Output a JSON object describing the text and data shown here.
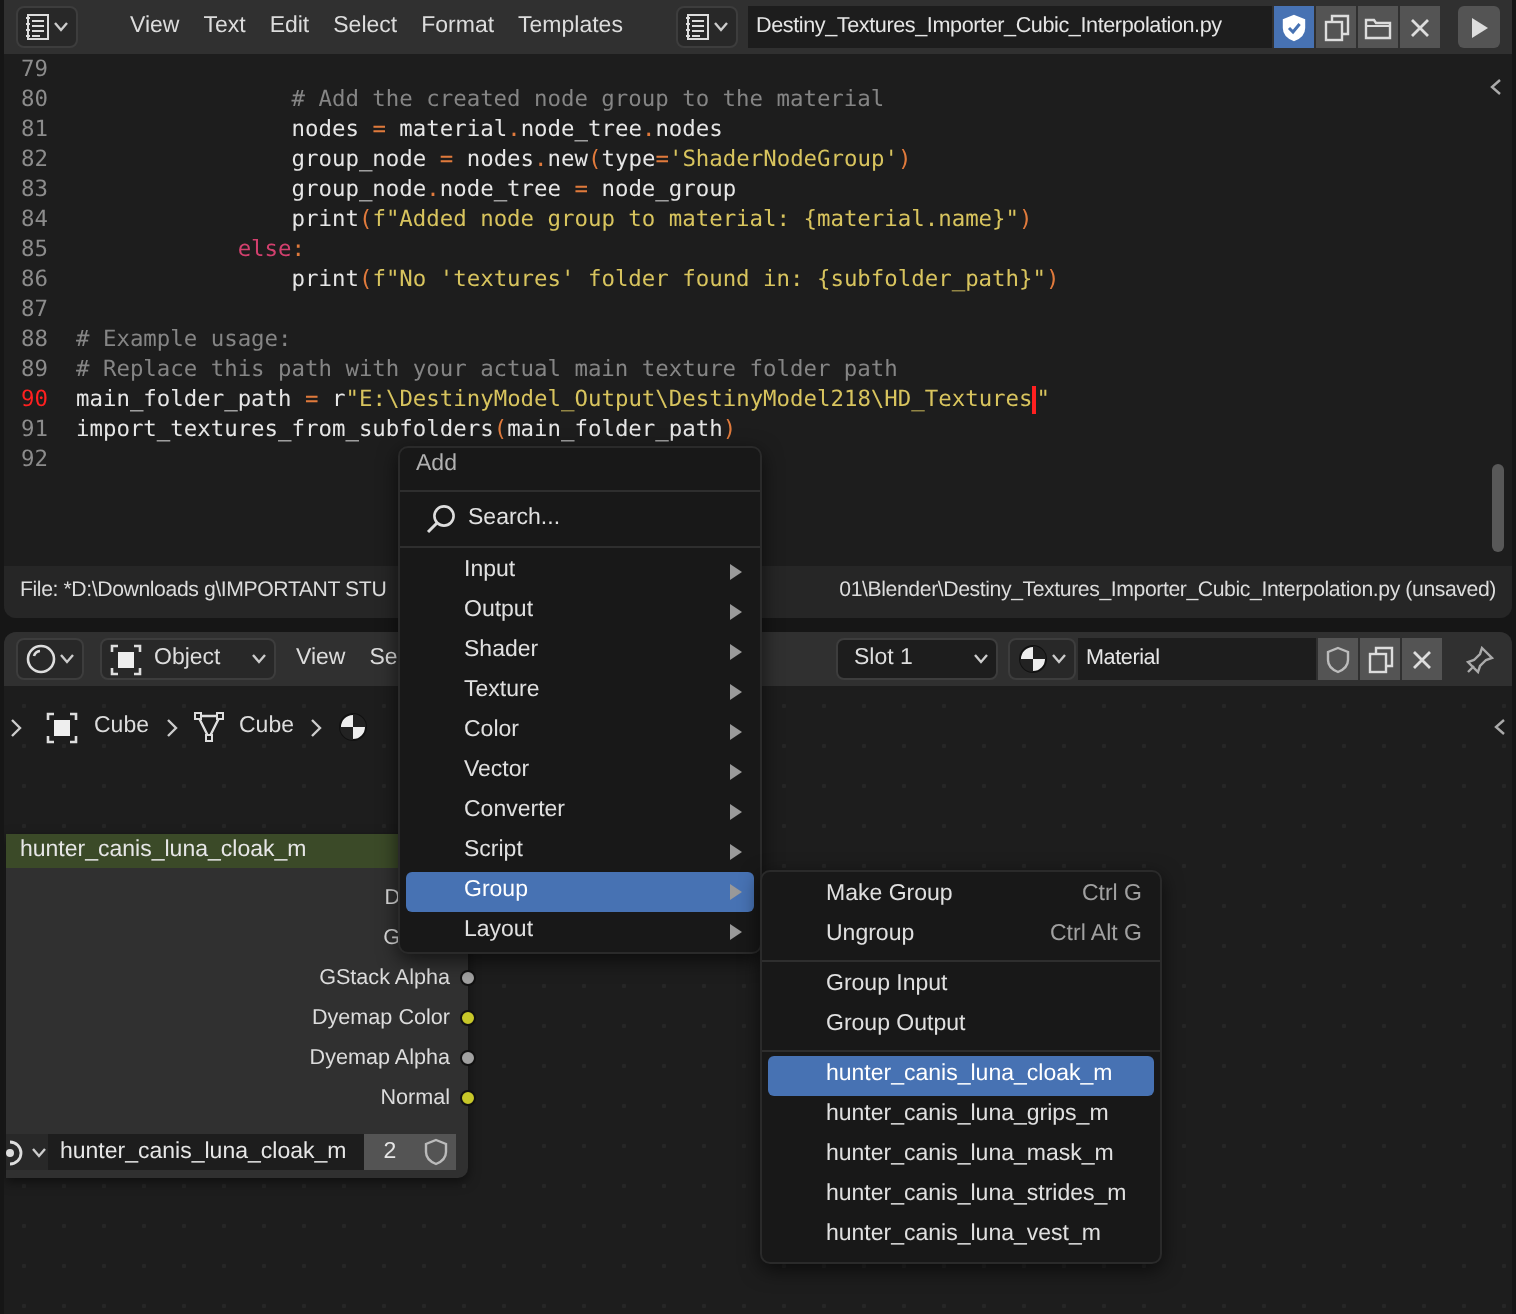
{
  "text_editor": {
    "header": {
      "menus": [
        "View",
        "Text",
        "Edit",
        "Select",
        "Format",
        "Templates"
      ],
      "filename": "Destiny_Textures_Importer_Cubic_Interpolation.py",
      "fake_user": true
    },
    "lines": [
      {
        "number": "79",
        "current": false
      },
      {
        "number": "80",
        "current": false,
        "segments": [
          {
            "kind": "comment",
            "text": "                # Add the created node group to the material"
          }
        ]
      },
      {
        "number": "81",
        "current": false,
        "segments": [
          {
            "kind": "plain",
            "text": "                nodes "
          },
          {
            "kind": "op",
            "text": "="
          },
          {
            "kind": "plain",
            "text": " material"
          },
          {
            "kind": "op",
            "text": "."
          },
          {
            "kind": "plain",
            "text": "node_tree"
          },
          {
            "kind": "op",
            "text": "."
          },
          {
            "kind": "plain",
            "text": "nodes"
          }
        ]
      },
      {
        "number": "82",
        "current": false,
        "segments": [
          {
            "kind": "plain",
            "text": "                group_node "
          },
          {
            "kind": "op",
            "text": "="
          },
          {
            "kind": "plain",
            "text": " nodes"
          },
          {
            "kind": "op",
            "text": "."
          },
          {
            "kind": "plain",
            "text": "new"
          },
          {
            "kind": "op",
            "text": "("
          },
          {
            "kind": "plain",
            "text": "type"
          },
          {
            "kind": "op",
            "text": "="
          },
          {
            "kind": "string",
            "text": "'ShaderNodeGroup'"
          },
          {
            "kind": "op",
            "text": ")"
          }
        ]
      },
      {
        "number": "83",
        "current": false,
        "segments": [
          {
            "kind": "plain",
            "text": "                group_node"
          },
          {
            "kind": "op",
            "text": "."
          },
          {
            "kind": "plain",
            "text": "node_tree "
          },
          {
            "kind": "op",
            "text": "="
          },
          {
            "kind": "plain",
            "text": " node_group"
          }
        ]
      },
      {
        "number": "84",
        "current": false,
        "segments": [
          {
            "kind": "plain",
            "text": "                print"
          },
          {
            "kind": "op",
            "text": "("
          },
          {
            "kind": "string",
            "text": "f\"Added node group to material: {material.name}\""
          },
          {
            "kind": "op",
            "text": ")"
          }
        ]
      },
      {
        "number": "85",
        "current": false,
        "segments": [
          {
            "kind": "keyword",
            "text": "            else"
          },
          {
            "kind": "op",
            "text": ":"
          }
        ]
      },
      {
        "number": "86",
        "current": false,
        "segments": [
          {
            "kind": "plain",
            "text": "                print"
          },
          {
            "kind": "op",
            "text": "("
          },
          {
            "kind": "string",
            "text": "f\"No 'textures' folder found in: {subfolder_path}\""
          },
          {
            "kind": "op",
            "text": ")"
          }
        ]
      },
      {
        "number": "87",
        "current": false
      },
      {
        "number": "88",
        "current": false,
        "segments": [
          {
            "kind": "comment",
            "text": "# Example usage:"
          }
        ]
      },
      {
        "number": "89",
        "current": false,
        "segments": [
          {
            "kind": "comment",
            "text": "# Replace this path with your actual main texture folder path"
          }
        ]
      },
      {
        "number": "90",
        "current": true,
        "segments": [
          {
            "kind": "plain",
            "text": "main_folder_path "
          },
          {
            "kind": "op",
            "text": "="
          },
          {
            "kind": "plain",
            "text": " r"
          },
          {
            "kind": "string",
            "text": "\"E:\\DestinyModel_Output\\DestinyModel218\\HD_Textures",
            "cursor_after": true
          },
          {
            "kind": "string",
            "text": "\""
          }
        ]
      },
      {
        "number": "91",
        "current": false,
        "segments": [
          {
            "kind": "plain",
            "text": "import_textures_from_subfolders"
          },
          {
            "kind": "op",
            "text": "("
          },
          {
            "kind": "plain",
            "text": "main_folder_path"
          },
          {
            "kind": "op",
            "text": ")"
          }
        ]
      },
      {
        "number": "92",
        "current": false
      }
    ],
    "status": [
      "File: *D:\\Downloads g\\IMPORTANT STU",
      "01\\Blender\\Destiny_Textures_Importer_Cubic_Interpolation.py (unsaved)"
    ]
  },
  "node_editor": {
    "header": {
      "mode": "Object",
      "menus": [
        "View",
        "Se"
      ],
      "slot": "Slot 1",
      "material": "Material",
      "fake_user": false
    },
    "breadcrumbs": [
      "Cube",
      "Cube"
    ],
    "node": {
      "title": "hunter_canis_luna_cloak_m",
      "outputs": [
        {
          "label": "D"
        },
        {
          "label": "G"
        },
        {
          "label": "GStack Alpha",
          "color": "#a1a1a1"
        },
        {
          "label": "Dyemap Color",
          "color": "#c7c729"
        },
        {
          "label": "Dyemap Alpha",
          "color": "#a1a1a1"
        },
        {
          "label": "Normal",
          "color": "#c7c729"
        }
      ],
      "datablock": "hunter_canis_luna_cloak_m",
      "users": "2",
      "fake_user": false
    }
  },
  "add_menu": {
    "title": "Add",
    "search": "Search...",
    "items": [
      {
        "label": "Input",
        "selected": false,
        "submenu": true
      },
      {
        "label": "Output",
        "selected": false,
        "submenu": true
      },
      {
        "label": "Shader",
        "selected": false,
        "submenu": true
      },
      {
        "label": "Texture",
        "selected": false,
        "submenu": true
      },
      {
        "label": "Color",
        "selected": false,
        "submenu": true
      },
      {
        "label": "Vector",
        "selected": false,
        "submenu": true
      },
      {
        "label": "Converter",
        "selected": false,
        "submenu": true
      },
      {
        "label": "Script",
        "selected": false,
        "submenu": true
      },
      {
        "label": "Group",
        "selected": true,
        "submenu": true
      },
      {
        "label": "Layout",
        "selected": false,
        "submenu": true
      }
    ]
  },
  "group_menu": {
    "sections": [
      {
        "items": [
          {
            "label": "Make Group",
            "shortcut": "Ctrl G",
            "selected": false
          },
          {
            "label": "Ungroup",
            "shortcut": "Ctrl Alt G",
            "selected": false
          }
        ]
      },
      {
        "items": [
          {
            "label": "Group Input",
            "selected": false
          },
          {
            "label": "Group Output",
            "selected": false
          }
        ]
      },
      {
        "items": [
          {
            "label": "hunter_canis_luna_cloak_m",
            "selected": true
          },
          {
            "label": "hunter_canis_luna_grips_m",
            "selected": false
          },
          {
            "label": "hunter_canis_luna_mask_m",
            "selected": false
          },
          {
            "label": "hunter_canis_luna_strides_m",
            "selected": false
          },
          {
            "label": "hunter_canis_luna_vest_m",
            "selected": false
          }
        ]
      }
    ]
  }
}
